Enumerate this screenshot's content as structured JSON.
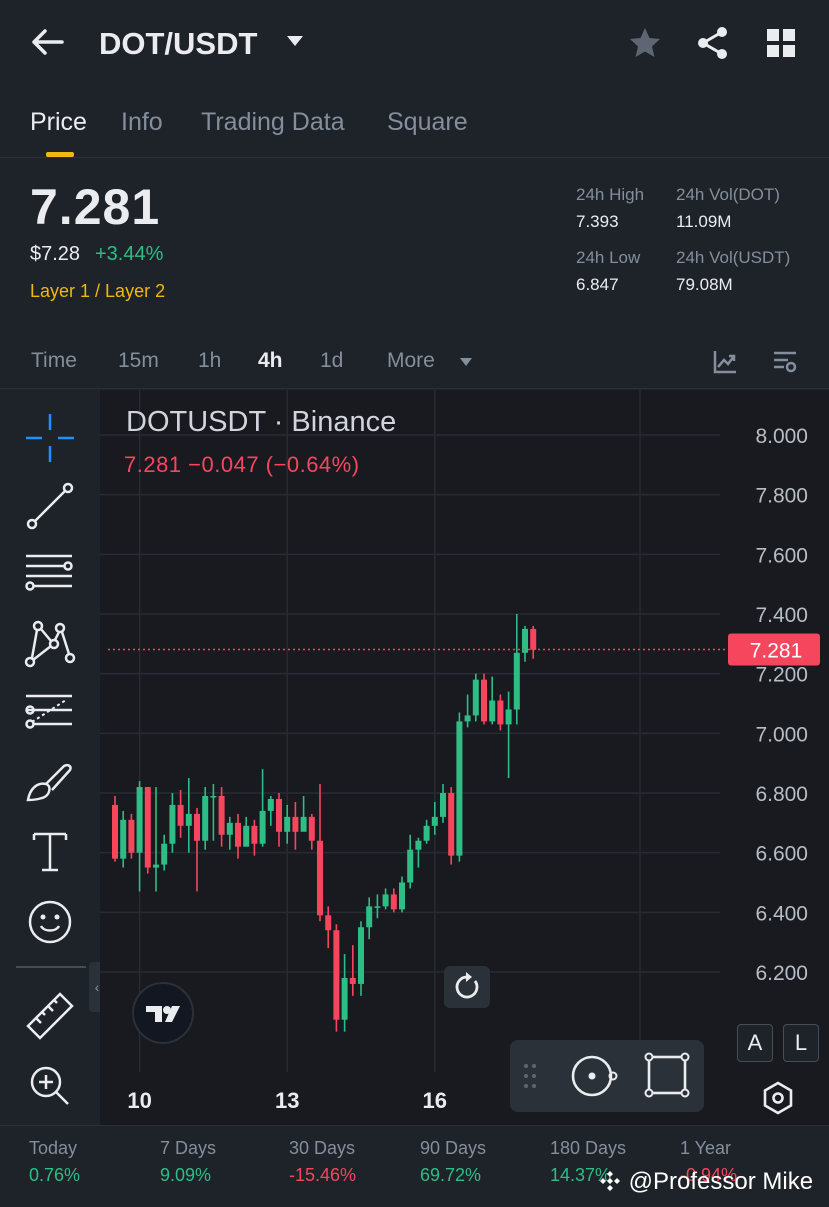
{
  "header": {
    "pair": "DOT/USDT"
  },
  "tabs": [
    {
      "label": "Price",
      "active": true
    },
    {
      "label": "Info",
      "active": false
    },
    {
      "label": "Trading Data",
      "active": false
    },
    {
      "label": "Square",
      "active": false
    }
  ],
  "ticker": {
    "last_price": "7.281",
    "usd_price": "$7.28",
    "change_pct": "+3.44%",
    "tag": "Layer 1 / Layer 2",
    "stats": {
      "high_label": "24h High",
      "high": "7.393",
      "low_label": "24h Low",
      "low": "6.847",
      "vol_base_label": "24h Vol(DOT)",
      "vol_base": "11.09M",
      "vol_quote_label": "24h Vol(USDT)",
      "vol_quote": "79.08M"
    }
  },
  "intervals": [
    {
      "label": "Time",
      "active": false
    },
    {
      "label": "15m",
      "active": false
    },
    {
      "label": "1h",
      "active": false
    },
    {
      "label": "4h",
      "active": true
    },
    {
      "label": "1d",
      "active": false
    },
    {
      "label": "More",
      "active": false
    }
  ],
  "chart": {
    "title": "DOTUSDT · Binance",
    "ohlc": "7.281  −0.047 (−0.64%)",
    "current_label": "7.281",
    "buttons": {
      "auto": "A",
      "log": "L"
    }
  },
  "colors": {
    "up": "#2ebd85",
    "down": "#f6465d",
    "accent": "#f0b90b"
  },
  "chart_data": {
    "type": "candlestick",
    "y_ticks": [
      "8.000",
      "7.800",
      "7.600",
      "7.400",
      "7.200",
      "7.000",
      "6.800",
      "6.600",
      "6.400",
      "6.200"
    ],
    "ylim": [
      6.0,
      8.1
    ],
    "x_ticks": [
      {
        "label": "10",
        "index": 3
      },
      {
        "label": "13",
        "index": 21
      },
      {
        "label": "16",
        "index": 39
      }
    ],
    "current_price": 7.281,
    "candles": [
      [
        6.76,
        6.58,
        6.79,
        6.57
      ],
      [
        6.58,
        6.71,
        6.74,
        6.55
      ],
      [
        6.71,
        6.6,
        6.73,
        6.58
      ],
      [
        6.6,
        6.82,
        6.84,
        6.47
      ],
      [
        6.82,
        6.55,
        6.82,
        6.53
      ],
      [
        6.55,
        6.56,
        6.82,
        6.47
      ],
      [
        6.56,
        6.63,
        6.66,
        6.54
      ],
      [
        6.63,
        6.76,
        6.8,
        6.6
      ],
      [
        6.76,
        6.69,
        6.81,
        6.65
      ],
      [
        6.69,
        6.73,
        6.85,
        6.6
      ],
      [
        6.73,
        6.64,
        6.75,
        6.47
      ],
      [
        6.64,
        6.79,
        6.82,
        6.61
      ],
      [
        6.79,
        6.79,
        6.83,
        6.64
      ],
      [
        6.79,
        6.66,
        6.82,
        6.62
      ],
      [
        6.66,
        6.7,
        6.72,
        6.61
      ],
      [
        6.7,
        6.62,
        6.73,
        6.58
      ],
      [
        6.62,
        6.69,
        6.72,
        6.64
      ],
      [
        6.69,
        6.63,
        6.71,
        6.59
      ],
      [
        6.63,
        6.74,
        6.88,
        6.62
      ],
      [
        6.74,
        6.78,
        6.79,
        6.69
      ],
      [
        6.78,
        6.67,
        6.8,
        6.62
      ],
      [
        6.67,
        6.72,
        6.76,
        6.63
      ],
      [
        6.72,
        6.67,
        6.77,
        6.61
      ],
      [
        6.67,
        6.72,
        6.79,
        6.68
      ],
      [
        6.72,
        6.64,
        6.73,
        6.61
      ],
      [
        6.64,
        6.39,
        6.83,
        6.37
      ],
      [
        6.39,
        6.34,
        6.42,
        6.28
      ],
      [
        6.34,
        6.04,
        6.36,
        6.0
      ],
      [
        6.04,
        6.18,
        6.26,
        6.0
      ],
      [
        6.18,
        6.16,
        6.29,
        6.12
      ],
      [
        6.16,
        6.35,
        6.37,
        6.12
      ],
      [
        6.35,
        6.42,
        6.45,
        6.31
      ],
      [
        6.42,
        6.42,
        6.46,
        6.38
      ],
      [
        6.42,
        6.46,
        6.48,
        6.41
      ],
      [
        6.46,
        6.41,
        6.48,
        6.4
      ],
      [
        6.41,
        6.5,
        6.52,
        6.4
      ],
      [
        6.5,
        6.61,
        6.66,
        6.48
      ],
      [
        6.61,
        6.64,
        6.65,
        6.55
      ],
      [
        6.64,
        6.69,
        6.71,
        6.63
      ],
      [
        6.69,
        6.72,
        6.77,
        6.66
      ],
      [
        6.72,
        6.8,
        6.83,
        6.7
      ],
      [
        6.8,
        6.59,
        6.82,
        6.56
      ],
      [
        6.59,
        7.04,
        7.07,
        6.57
      ],
      [
        7.04,
        7.06,
        7.13,
        7.02
      ],
      [
        7.06,
        7.18,
        7.2,
        7.04
      ],
      [
        7.18,
        7.04,
        7.2,
        7.03
      ],
      [
        7.04,
        7.11,
        7.19,
        7.03
      ],
      [
        7.11,
        7.03,
        7.13,
        7.01
      ],
      [
        7.03,
        7.08,
        7.14,
        6.85
      ],
      [
        7.08,
        7.27,
        7.4,
        7.03
      ],
      [
        7.27,
        7.35,
        7.36,
        7.24
      ],
      [
        7.35,
        7.28,
        7.36,
        7.25
      ]
    ]
  },
  "performance": [
    {
      "label": "Today",
      "value": "0.76%"
    },
    {
      "label": "7 Days",
      "value": "9.09%"
    },
    {
      "label": "30 Days",
      "value": "-15.46%"
    },
    {
      "label": "90 Days",
      "value": "69.72%"
    },
    {
      "label": "180 Days",
      "value": "14.37%"
    },
    {
      "label": "1 Year",
      "value": "-0.94%"
    }
  ],
  "watermark": "@Professor Mike"
}
